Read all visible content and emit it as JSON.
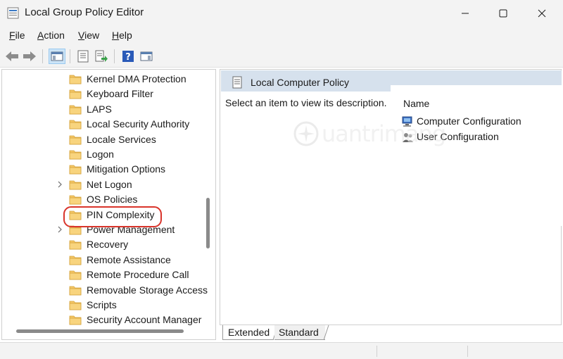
{
  "window": {
    "title": "Local Group Policy Editor"
  },
  "menu": {
    "items": [
      {
        "label": "File",
        "accel": "F",
        "rest": "ile"
      },
      {
        "label": "Action",
        "accel": "A",
        "rest": "ction"
      },
      {
        "label": "View",
        "accel": "V",
        "rest": "iew"
      },
      {
        "label": "Help",
        "accel": "H",
        "rest": "elp"
      }
    ]
  },
  "toolbar": {
    "icons": [
      "back-arrow-icon",
      "forward-arrow-icon",
      "show-hide-console-tree-icon",
      "properties-icon",
      "export-list-icon",
      "help-icon",
      "show-hide-action-pane-icon"
    ]
  },
  "tree": {
    "items": [
      {
        "label": "Kernel DMA Protection",
        "expandable": false
      },
      {
        "label": "Keyboard Filter",
        "expandable": false
      },
      {
        "label": "LAPS",
        "expandable": false
      },
      {
        "label": "Local Security Authority",
        "expandable": false
      },
      {
        "label": "Locale Services",
        "expandable": false
      },
      {
        "label": "Logon",
        "expandable": false
      },
      {
        "label": "Mitigation Options",
        "expandable": false
      },
      {
        "label": "Net Logon",
        "expandable": true
      },
      {
        "label": "OS Policies",
        "expandable": false
      },
      {
        "label": "PIN Complexity",
        "expandable": false,
        "highlighted": true
      },
      {
        "label": "Power Management",
        "expandable": true
      },
      {
        "label": "Recovery",
        "expandable": false
      },
      {
        "label": "Remote Assistance",
        "expandable": false
      },
      {
        "label": "Remote Procedure Call",
        "expandable": false
      },
      {
        "label": "Removable Storage Access",
        "expandable": false
      },
      {
        "label": "Scripts",
        "expandable": false
      },
      {
        "label": "Security Account Manager",
        "expandable": false
      }
    ]
  },
  "right_pane": {
    "header": "Local Computer Policy",
    "description": "Select an item to view its description.",
    "column_name": "Name",
    "items": [
      {
        "label": "Computer Configuration",
        "icon": "computer-icon"
      },
      {
        "label": "User Configuration",
        "icon": "users-icon"
      }
    ]
  },
  "tabs": {
    "extended": "Extended",
    "standard": "Standard"
  },
  "watermark": {
    "text": "uantrimang"
  },
  "colors": {
    "highlight_ring": "#d9342b",
    "folder": "#f5c767",
    "header_band": "#d6e1ed"
  }
}
